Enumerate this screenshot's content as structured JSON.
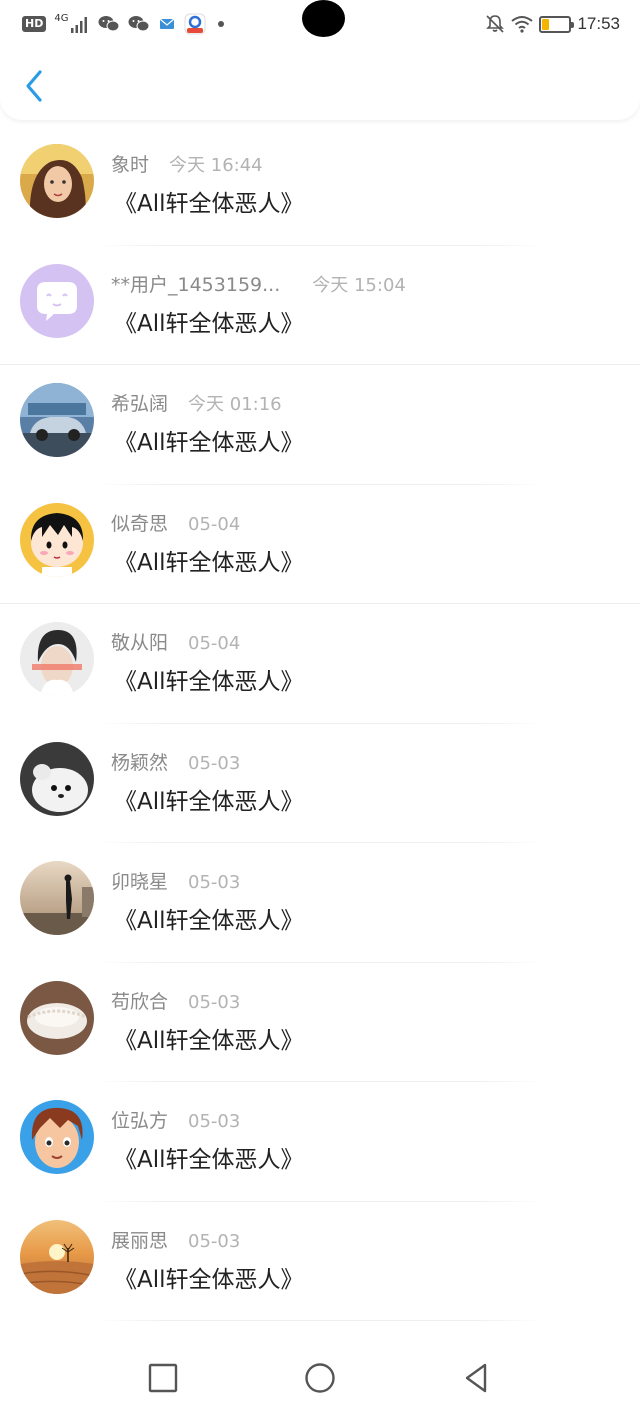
{
  "status_bar": {
    "hd": "HD",
    "network": "4G",
    "time": "17:53",
    "icons": [
      "signal-icon",
      "wechat-icon",
      "wechat-icon",
      "mail-icon",
      "app-icon",
      "notification-dot",
      "mute-bell-icon",
      "wifi-icon",
      "battery-icon"
    ],
    "battery_level": 0.25
  },
  "header": {
    "back_icon": "chevron-left-icon",
    "accent": "#2a9be6"
  },
  "items": [
    {
      "name": "象时",
      "time": "今天 16:44",
      "title": "《All轩全体恶人》",
      "avatar": "photo-girl"
    },
    {
      "name": "**用户_1453159...",
      "time": "今天 15:04",
      "title": "《All轩全体恶人》",
      "avatar": "default-purple"
    },
    {
      "name": "希弘阔",
      "time": "今天 01:16",
      "title": "《All轩全体恶人》",
      "avatar": "photo-car"
    },
    {
      "name": "似奇思",
      "time": "05-04",
      "title": "《All轩全体恶人》",
      "avatar": "cartoon-girl"
    },
    {
      "name": "敬从阳",
      "time": "05-04",
      "title": "《All轩全体恶人》",
      "avatar": "photo-person"
    },
    {
      "name": "杨颖然",
      "time": "05-03",
      "title": "《All轩全体恶人》",
      "avatar": "photo-puppy"
    },
    {
      "name": "卯晓星",
      "time": "05-03",
      "title": "《All轩全体恶人》",
      "avatar": "photo-beach"
    },
    {
      "name": "苟欣合",
      "time": "05-03",
      "title": "《All轩全体恶人》",
      "avatar": "photo-bowl"
    },
    {
      "name": "位弘方",
      "time": "05-03",
      "title": "《All轩全体恶人》",
      "avatar": "cartoon-boy"
    },
    {
      "name": "展丽思",
      "time": "05-03",
      "title": "《All轩全体恶人》",
      "avatar": "photo-desert"
    }
  ],
  "nav_bar": {
    "icons": [
      "recents-square-icon",
      "home-circle-icon",
      "back-triangle-icon"
    ]
  }
}
